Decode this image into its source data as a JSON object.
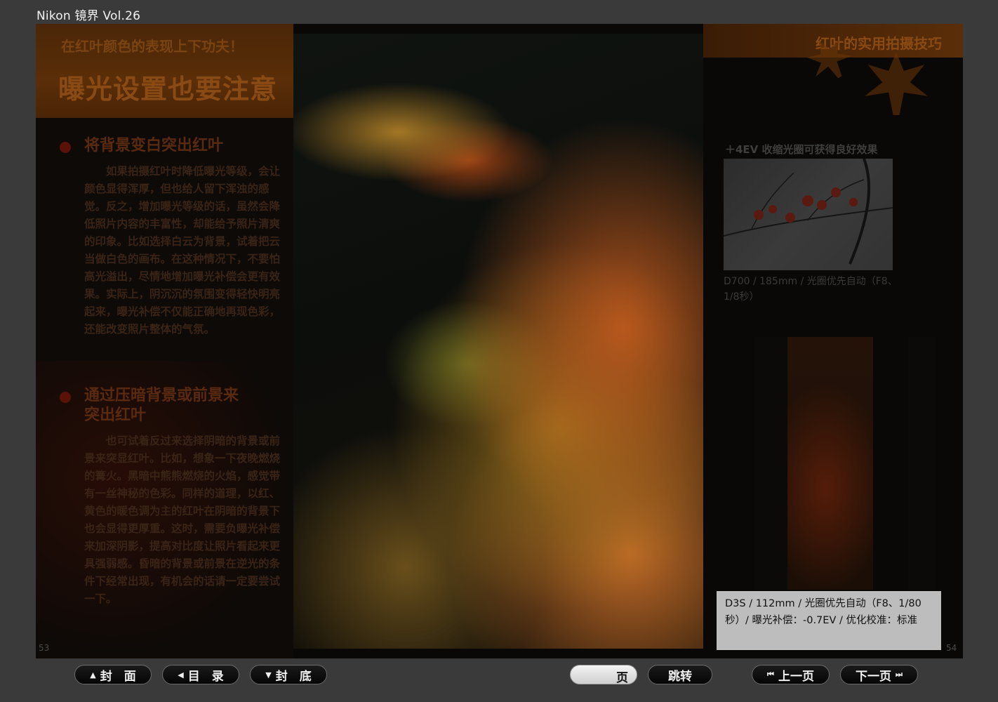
{
  "app": {
    "title": "Nikon 镜界 Vol.26"
  },
  "left_page": {
    "subtitle": "在红叶颜色的表现上下功夫！",
    "title": "曝光设置也要注意",
    "sections": [
      {
        "heading": "将背景变白突出红叶",
        "body": "如果拍摄红叶时降低曝光等级，会让颜色显得浑厚，但也给人留下浑浊的感觉。反之，增加曝光等级的话，虽然会降低照片内容的丰富性，却能给予照片清爽的印象。比如选择白云为背景，试着把云当做白色的画布。在这种情况下，不要怕高光溢出，尽情地增加曝光补偿会更有效果。实际上，阴沉沉的氛围变得轻快明亮起来，曝光补偿不仅能正确地再现色彩，还能改变照片整体的气氛。"
      },
      {
        "heading_line1": "通过压暗背景或前景来",
        "heading_line2": "突出红叶",
        "body": "也可试着反过来选择阴暗的背景或前景来突显红叶。比如，想象一下夜晚燃烧的篝火。黑暗中熊熊燃烧的火焰，感觉带有一丝神秘的色彩。同样的道理，以红、黄色的暖色调为主的红叶在阴暗的背景下也会显得更厚重。这时，需要负曝光补偿来加深阴影，提高对比度让照片看起来更具强弱感。昏暗的背景或前景在逆光的条件下经常出现，有机会的话请一定要尝试一下。"
      }
    ],
    "page_number": "53"
  },
  "right_page": {
    "title": "红叶的实用拍摄技巧",
    "caption1_title": "＋4EV 收缩光圈可获得良好效果",
    "caption1_body": "D700 / 185mm / 光圈优先自动（F8、1/8秒）",
    "caption2": "D3S / 112mm / 光圈优先自动（F8、1/80秒）/ 曝光补偿：-0.7EV / 优化校准：标准",
    "page_number": "54"
  },
  "nav": {
    "cover": "封　面",
    "toc": "目　录",
    "back_cover": "封　底",
    "page_input_value": "",
    "page_suffix": "页",
    "jump": "跳转",
    "prev": "上一页",
    "next": "下一页"
  }
}
